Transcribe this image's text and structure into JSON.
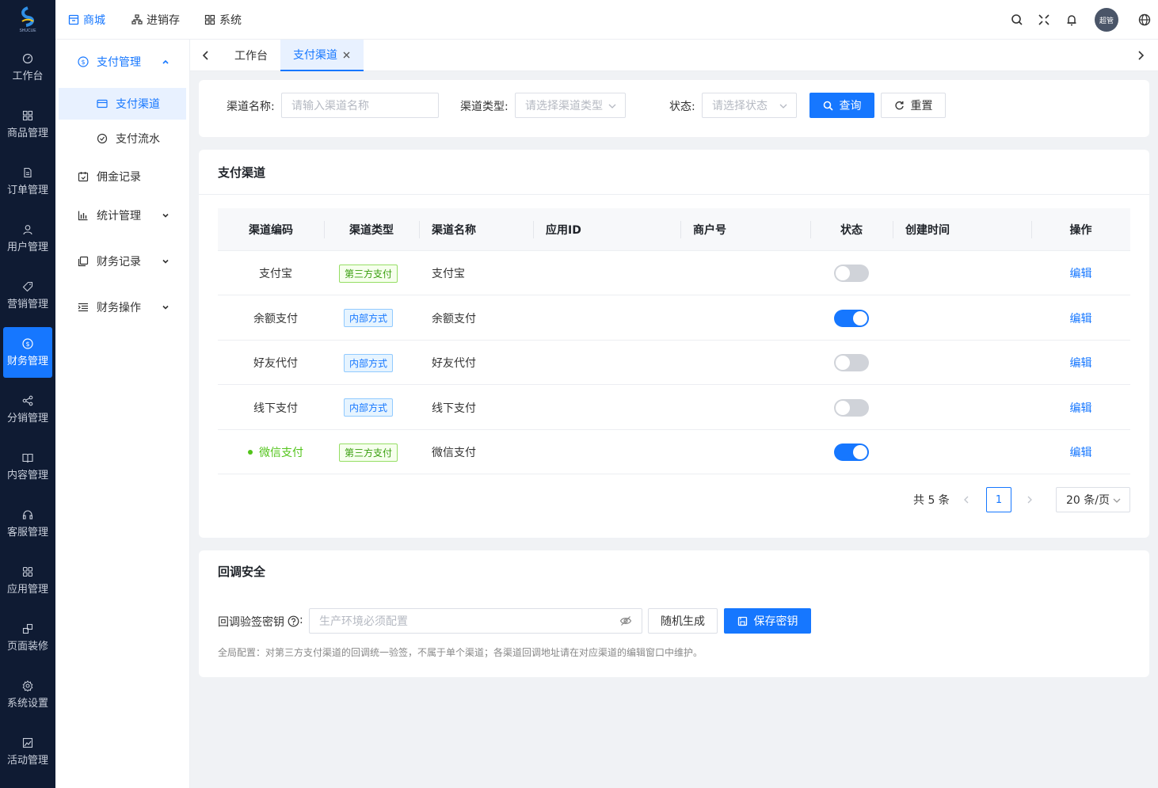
{
  "brand": {
    "logo_text": "SHUCUE"
  },
  "rail": {
    "items": [
      {
        "label": "工作台",
        "icon": "dashboard-icon"
      },
      {
        "label": "商品管理",
        "icon": "grid-icon"
      },
      {
        "label": "订单管理",
        "icon": "file-icon"
      },
      {
        "label": "用户管理",
        "icon": "user-icon"
      },
      {
        "label": "营销管理",
        "icon": "tag-icon"
      },
      {
        "label": "财务管理",
        "icon": "dollar-icon"
      },
      {
        "label": "分销管理",
        "icon": "share-icon"
      },
      {
        "label": "内容管理",
        "icon": "book-icon"
      },
      {
        "label": "客服管理",
        "icon": "headset-icon"
      },
      {
        "label": "应用管理",
        "icon": "apps-icon"
      },
      {
        "label": "页面装修",
        "icon": "layout-icon"
      },
      {
        "label": "系统设置",
        "icon": "settings-icon"
      },
      {
        "label": "活动管理",
        "icon": "image-icon"
      }
    ],
    "active": "财务管理"
  },
  "topnav": {
    "items": [
      {
        "label": "商城",
        "icon": "store-icon"
      },
      {
        "label": "进销存",
        "icon": "inventory-icon"
      },
      {
        "label": "系统",
        "icon": "system-icon"
      }
    ],
    "active": "商城",
    "avatar_text": "超管"
  },
  "submenu": {
    "group_label": "支付管理",
    "items": [
      {
        "label": "支付渠道",
        "icon": "card-icon"
      },
      {
        "label": "支付流水",
        "icon": "flow-icon"
      },
      {
        "label": "佣金记录",
        "icon": "calendar-icon"
      },
      {
        "label": "统计管理",
        "icon": "chart-icon"
      },
      {
        "label": "财务记录",
        "icon": "copy-icon"
      },
      {
        "label": "财务操作",
        "icon": "indent-icon"
      }
    ],
    "active": "支付渠道"
  },
  "tabs": {
    "items": [
      "工作台",
      "支付渠道"
    ],
    "active": "支付渠道"
  },
  "filter": {
    "channel_name_label": "渠道名称:",
    "channel_name_placeholder": "请输入渠道名称",
    "channel_type_label": "渠道类型:",
    "channel_type_placeholder": "请选择渠道类型",
    "status_label": "状态:",
    "status_placeholder": "请选择状态",
    "search_label": "查询",
    "reset_label": "重置"
  },
  "channels": {
    "title": "支付渠道",
    "columns": [
      "渠道编码",
      "渠道类型",
      "渠道名称",
      "应用ID",
      "商户号",
      "状态",
      "创建时间",
      "操作"
    ],
    "rows": [
      {
        "code": "支付宝",
        "type": "第三方支付",
        "type_color": "green",
        "name": "支付宝",
        "enabled": false,
        "action": "编辑",
        "highlight": false
      },
      {
        "code": "余额支付",
        "type": "内部方式",
        "type_color": "blue",
        "name": "余额支付",
        "enabled": true,
        "action": "编辑",
        "highlight": false
      },
      {
        "code": "好友代付",
        "type": "内部方式",
        "type_color": "blue",
        "name": "好友代付",
        "enabled": false,
        "action": "编辑",
        "highlight": false
      },
      {
        "code": "线下支付",
        "type": "内部方式",
        "type_color": "blue",
        "name": "线下支付",
        "enabled": false,
        "action": "编辑",
        "highlight": false
      },
      {
        "code": "微信支付",
        "type": "第三方支付",
        "type_color": "green",
        "name": "微信支付",
        "enabled": true,
        "action": "编辑",
        "highlight": true
      }
    ],
    "pagination": {
      "total": "共 5 条",
      "current_page": "1",
      "page_size": "20 条/页"
    }
  },
  "callback": {
    "title": "回调安全",
    "key_label": "回调验签密钥",
    "key_placeholder": "生产环境必须配置",
    "random_label": "随机生成",
    "save_label": "保存密钥",
    "hint": "全局配置：对第三方支付渠道的回调统一验签，不属于单个渠道；各渠道回调地址请在对应渠道的编辑窗口中维护。"
  },
  "colors": {
    "primary": "#1677ff",
    "rail_bg": "#0f1b33",
    "success": "#52c41a"
  }
}
